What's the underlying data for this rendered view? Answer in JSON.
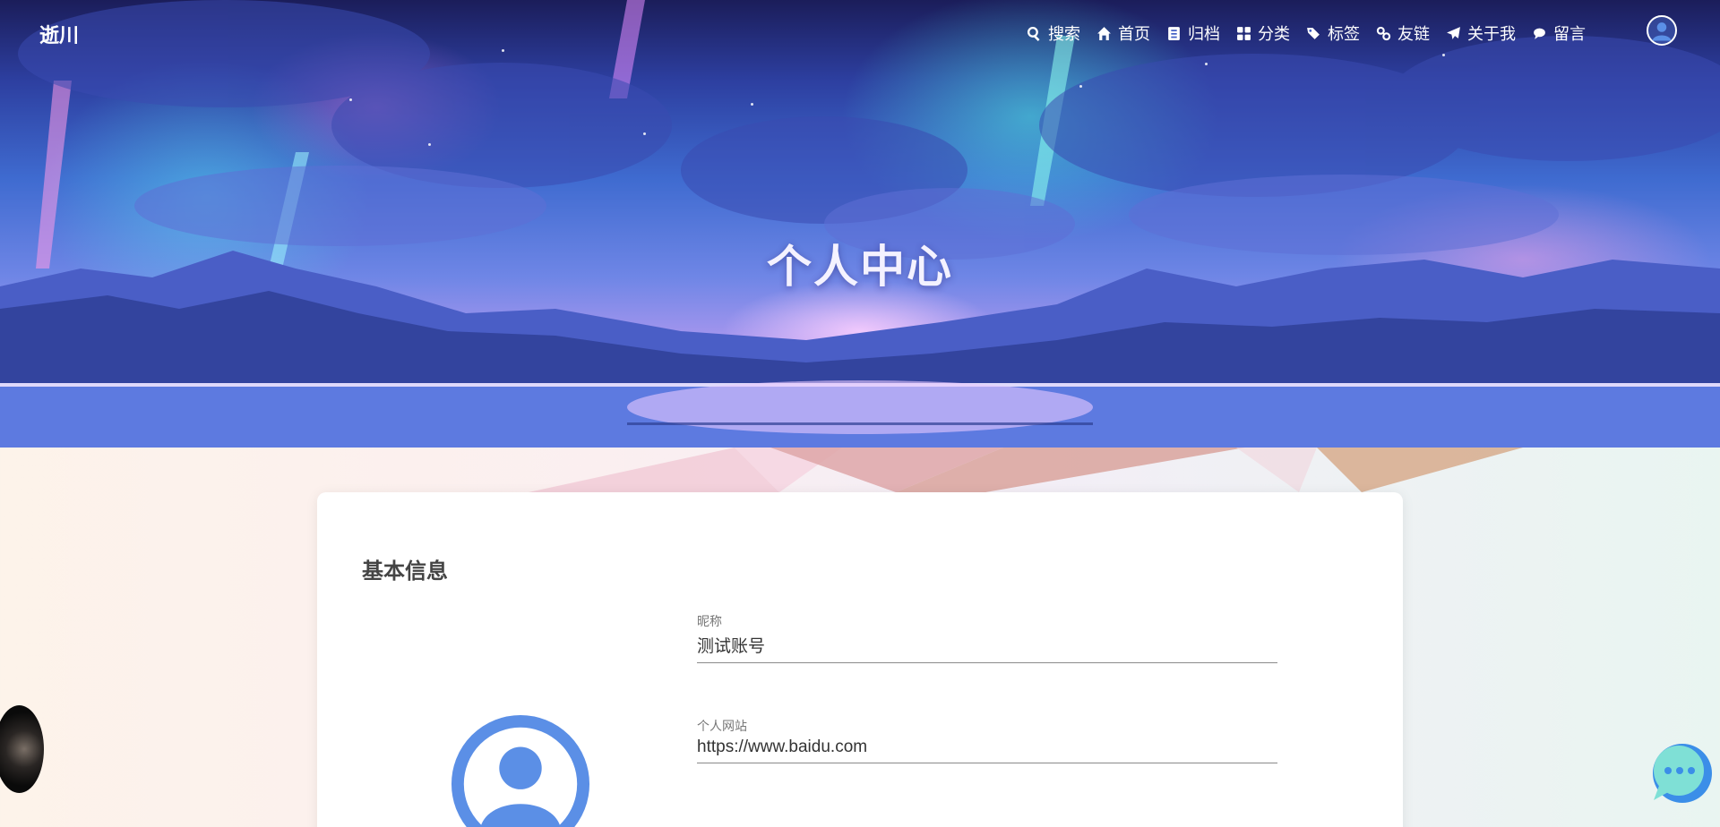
{
  "site": {
    "brand": "逝川"
  },
  "nav": {
    "items": [
      {
        "label": "搜索",
        "icon": "search-icon"
      },
      {
        "label": "首页",
        "icon": "home-icon"
      },
      {
        "label": "归档",
        "icon": "archive-icon"
      },
      {
        "label": "分类",
        "icon": "category-icon"
      },
      {
        "label": "标签",
        "icon": "tags-icon"
      },
      {
        "label": "友链",
        "icon": "link-icon"
      },
      {
        "label": "关于我",
        "icon": "paper-plane-icon"
      },
      {
        "label": "留言",
        "icon": "comments-icon"
      }
    ],
    "user_icon": "user-circle-icon"
  },
  "hero": {
    "title": "个人中心"
  },
  "profile": {
    "section_title": "基本信息",
    "fields": [
      {
        "label": "昵称",
        "value": "测试账号"
      },
      {
        "label": "个人网站",
        "value": "https://www.baidu.com"
      },
      {
        "label": "",
        "value": ""
      }
    ]
  },
  "colors": {
    "avatar_blue": "#5b8fe6",
    "chat_blue": "#3b8ee8",
    "chat_teal": "#7fe0d6"
  }
}
